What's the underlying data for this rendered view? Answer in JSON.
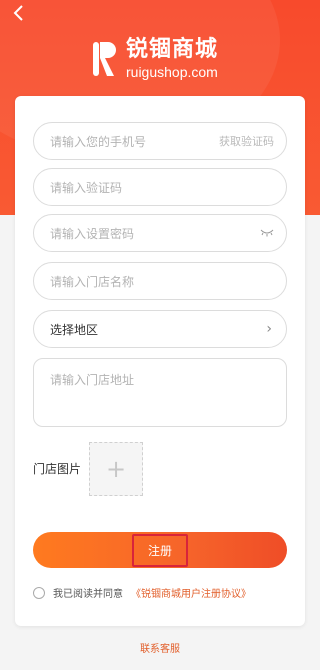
{
  "header": {
    "back_icon": "chevron-left-icon",
    "logo_cn": "锐锢商城",
    "logo_en": "ruigushop.com"
  },
  "form": {
    "phone": {
      "placeholder": "请输入您的手机号",
      "action": "获取验证码"
    },
    "code": {
      "placeholder": "请输入验证码"
    },
    "password": {
      "placeholder": "请输入设置密码",
      "icon": "eye-closed-icon"
    },
    "store_name": {
      "placeholder": "请输入门店名称"
    },
    "region": {
      "value": "选择地区",
      "icon": "chevron-right-icon"
    },
    "address": {
      "placeholder": "请输入门店地址"
    },
    "photo": {
      "label": "门店图片",
      "icon": "plus-icon"
    },
    "submit_label": "注册",
    "agreement_prefix": "我已阅读并同意",
    "agreement_link": "《锐锢商城用户注册协议》"
  },
  "footer": {
    "service": "联系客服"
  },
  "colors": {
    "brand": "#f84a2c",
    "accent": "#e25f2b"
  }
}
